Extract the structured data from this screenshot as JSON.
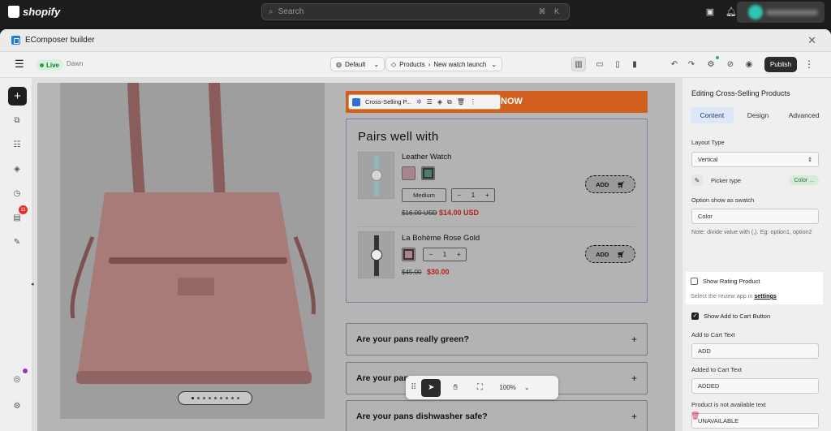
{
  "shopify": {
    "logo_text": "shopify",
    "search_placeholder": "Search",
    "search_shortcut": "⌘ K"
  },
  "window": {
    "title": "EComposer builder"
  },
  "toolbar": {
    "live_label": "Live",
    "theme_name": "Dawn",
    "device_label": "Default",
    "breadcrumb_section": "Products",
    "breadcrumb_page": "New watch launch",
    "publish_label": "Publish"
  },
  "rail": {
    "badge_count": "11"
  },
  "canvas": {
    "banner_text": "NOW",
    "selected_element_label": "Cross-Selling P...",
    "pairs_title": "Pairs well with",
    "products": [
      {
        "name": "Leather Watch",
        "size": "Medium",
        "qty": "1",
        "old_price": "$16.00 USD",
        "new_price": "$14.00 USD",
        "add_label": "ADD"
      },
      {
        "name": "La Bohème Rose Gold",
        "qty": "1",
        "old_price": "$45.00",
        "new_price": "$30.00",
        "add_label": "ADD"
      }
    ],
    "faqs": [
      "Are your pans really green?",
      "Are your pans safe for metal?",
      "Are your pans dishwasher safe?"
    ],
    "faq_visible": [
      "Are your pans really green?",
      "Are your pan",
      "Are your pans dishwasher safe?"
    ],
    "zoom_level": "100%"
  },
  "panel": {
    "title": "Editing Cross-Selling Products",
    "tabs": [
      "Content",
      "Design",
      "Advanced"
    ],
    "layout_type_label": "Layout Type",
    "layout_type_value": "Vertical",
    "picker_type_label": "Picker type",
    "picker_type_value": "Color ...",
    "swatch_label": "Option show as swatch",
    "swatch_value": "Color",
    "swatch_note": "Note: divide value with (,). Eg: option1, option2",
    "show_rating_label": "Show Rating Product",
    "review_note": "Select the review app in",
    "review_link": "settings",
    "show_add_to_cart_label": "Show Add to Cart Button",
    "add_to_cart_text_label": "Add to Cart Text",
    "add_to_cart_text_value": "ADD",
    "added_to_cart_text_label": "Added to Cart Text",
    "added_to_cart_text_value": "ADDED",
    "unavailable_label": "Product is not available text",
    "unavailable_value": "UNAVAILABLE"
  },
  "colors": {
    "accent_orange": "#d15f1f",
    "live_green": "#22a846",
    "sale_red": "#b3231b",
    "tab_active": "#dde7f7",
    "danger": "#d6336c"
  }
}
